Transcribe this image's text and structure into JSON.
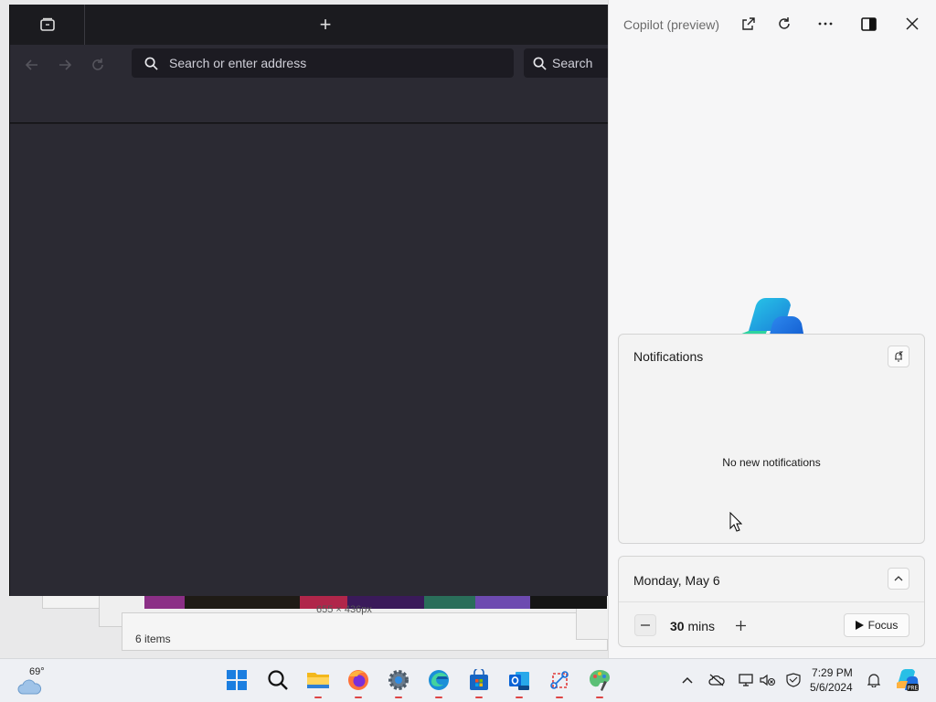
{
  "browser": {
    "new_tab_symbol": "+",
    "address_placeholder": "Search or enter address",
    "search_placeholder": "Search",
    "colors": {
      "frame": "#1b1b1f",
      "toolbar": "#2b2a33",
      "field": "#1c1b22"
    }
  },
  "background": {
    "status_items": "6 items",
    "dimensions_text": "655 × 436px"
  },
  "copilot": {
    "title": "Copilot (preview)",
    "icons": [
      "open-external-icon",
      "refresh-icon",
      "more-icon",
      "split-view-icon",
      "close-icon"
    ]
  },
  "notifications": {
    "title": "Notifications",
    "empty_text": "No new notifications"
  },
  "calendar": {
    "date": "Monday, May 6",
    "focus_minutes": "30",
    "focus_unit": "mins",
    "focus_label": "Focus"
  },
  "taskbar": {
    "temperature": "69°",
    "apps": [
      "start-icon",
      "search-icon",
      "file-explorer-icon",
      "firefox-icon",
      "settings-icon",
      "edge-icon",
      "store-icon",
      "outlook-icon",
      "snipping-tool-icon",
      "paint-icon"
    ],
    "time": "7:29 PM",
    "date": "5/6/2024",
    "accent": "#0a64d6"
  }
}
